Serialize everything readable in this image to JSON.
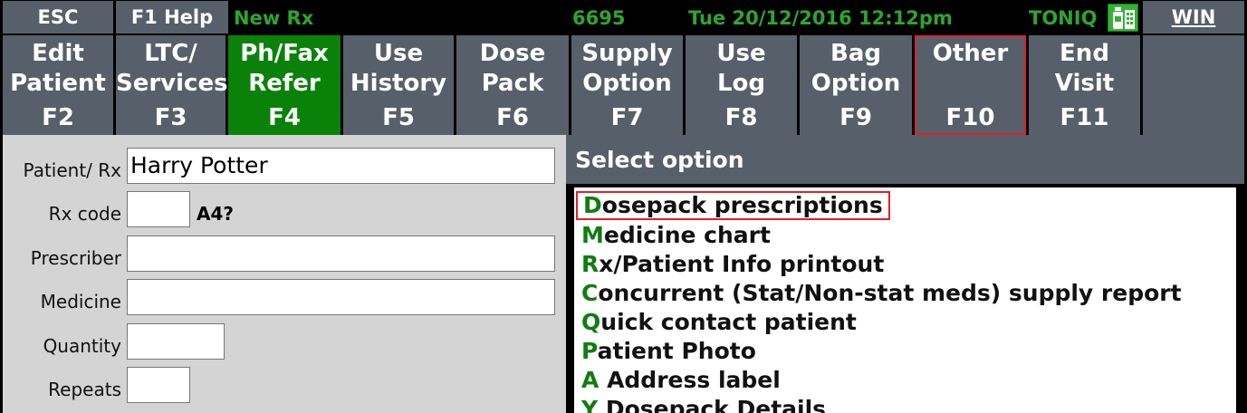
{
  "topbar": {
    "esc": "ESC",
    "help": "F1 Help",
    "mode": "New Rx",
    "number": "6695",
    "datetime": "Tue 20/12/2016 12:12pm",
    "brand": "TONIQ",
    "brand_icon": "pharmacy-icon",
    "win_label": "WIN",
    "text_color": "#2ea52e"
  },
  "fkeys": [
    {
      "label": "Edit\nPatient",
      "key": "F2"
    },
    {
      "label": "LTC/\nServices",
      "key": "F3"
    },
    {
      "label": "Ph/Fax\nRefer",
      "key": "F4"
    },
    {
      "label": "Use\nHistory",
      "key": "F5"
    },
    {
      "label": "Dose\nPack",
      "key": "F6"
    },
    {
      "label": "Supply\nOption",
      "key": "F7"
    },
    {
      "label": "Use\nLog",
      "key": "F8"
    },
    {
      "label": "Bag\nOption",
      "key": "F9"
    },
    {
      "label": "Other",
      "key": "F10"
    },
    {
      "label": "End\nVisit",
      "key": "F11"
    }
  ],
  "form": {
    "patient_label": "Patient/ Rx",
    "patient_value": "Harry Potter",
    "rxcode_label": "Rx code",
    "rxcode_value": "",
    "rxcode_flag": "A4?",
    "prescriber_label": "Prescriber",
    "prescriber_value": "",
    "medicine_label": "Medicine",
    "medicine_value": "",
    "quantity_label": "Quantity",
    "quantity_value": "",
    "repeats_label": "Repeats",
    "repeats_value": ""
  },
  "options": {
    "title": "Select option",
    "items": [
      {
        "key": "D",
        "text": "osepack prescriptions"
      },
      {
        "key": "M",
        "text": "edicine chart"
      },
      {
        "key": "R",
        "text": "x/Patient Info printout"
      },
      {
        "key": "C",
        "text": "oncurrent (Stat/Non-stat meds) supply report"
      },
      {
        "key": "Q",
        "text": "uick contact patient"
      },
      {
        "key": "P",
        "text": "atient Photo"
      },
      {
        "key": "A",
        "text": " Address label"
      },
      {
        "key": "Y",
        "text": " Dosepack Details"
      }
    ]
  },
  "colors": {
    "bar_gray": "#57606a",
    "active_green": "#0a820a",
    "hotkey_green": "#0f7d0f",
    "highlight_red": "#e0202c"
  }
}
